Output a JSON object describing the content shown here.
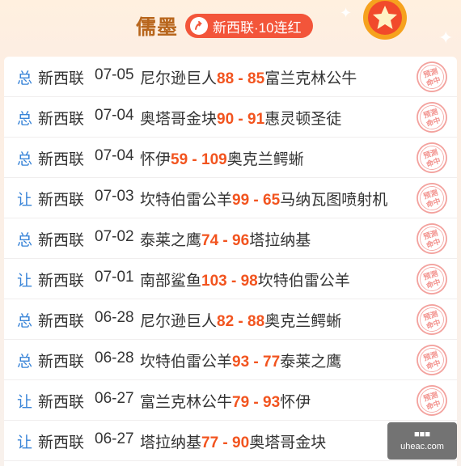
{
  "header": {
    "author": "儒墨",
    "streak": "新西联·10连红",
    "colors": {
      "author": "#b8661d",
      "badge": "#f3553a",
      "score": "#f2541f",
      "type": "#3a85d8"
    }
  },
  "rows": [
    {
      "type": "总",
      "league": "新西联",
      "date": "07-05",
      "home": "尼尔逊巨人",
      "home_score": "88",
      "sep": " - ",
      "away_score": "85",
      "away": "富兰克林公牛",
      "stamp": "预测命中"
    },
    {
      "type": "总",
      "league": "新西联",
      "date": "07-04",
      "home": "奥塔哥金块",
      "home_score": "90",
      "sep": " - ",
      "away_score": "91",
      "away": "惠灵顿圣徒",
      "stamp": "预测命中"
    },
    {
      "type": "总",
      "league": "新西联",
      "date": "07-04",
      "home": "怀伊",
      "home_score": "59",
      "sep": " - ",
      "away_score": "109",
      "away": "奥克兰鳄蜥",
      "stamp": "预测命中"
    },
    {
      "type": "让",
      "league": "新西联",
      "date": "07-03",
      "home": "坎特伯雷公羊",
      "home_score": "99",
      "sep": " - ",
      "away_score": "65",
      "away": "马纳瓦图喷射机",
      "stamp": "预测命中"
    },
    {
      "type": "总",
      "league": "新西联",
      "date": "07-02",
      "home": "泰莱之鹰",
      "home_score": "74",
      "sep": " - ",
      "away_score": "96",
      "away": "塔拉纳基",
      "stamp": "预测命中"
    },
    {
      "type": "让",
      "league": "新西联",
      "date": "07-01",
      "home": "南部鲨鱼",
      "home_score": "103",
      "sep": " - ",
      "away_score": "98",
      "away": "坎特伯雷公羊",
      "stamp": "预测命中"
    },
    {
      "type": "总",
      "league": "新西联",
      "date": "06-28",
      "home": "尼尔逊巨人",
      "home_score": "82",
      "sep": " - ",
      "away_score": "88",
      "away": "奥克兰鳄蜥",
      "stamp": "预测命中"
    },
    {
      "type": "总",
      "league": "新西联",
      "date": "06-28",
      "home": "坎特伯雷公羊",
      "home_score": "93",
      "sep": " - ",
      "away_score": "77",
      "away": "泰莱之鹰",
      "stamp": "预测命中"
    },
    {
      "type": "让",
      "league": "新西联",
      "date": "06-27",
      "home": "富兰克林公牛",
      "home_score": "79",
      "sep": " - ",
      "away_score": "93",
      "away": "怀伊",
      "stamp": "预测命中"
    },
    {
      "type": "让",
      "league": "新西联",
      "date": "06-27",
      "home": "塔拉纳基",
      "home_score": "77",
      "sep": " - ",
      "away_score": "90",
      "away": "奥塔哥金块",
      "stamp": ""
    }
  ],
  "watermark": {
    "line1": "■■■",
    "line2": "uheac.com"
  }
}
